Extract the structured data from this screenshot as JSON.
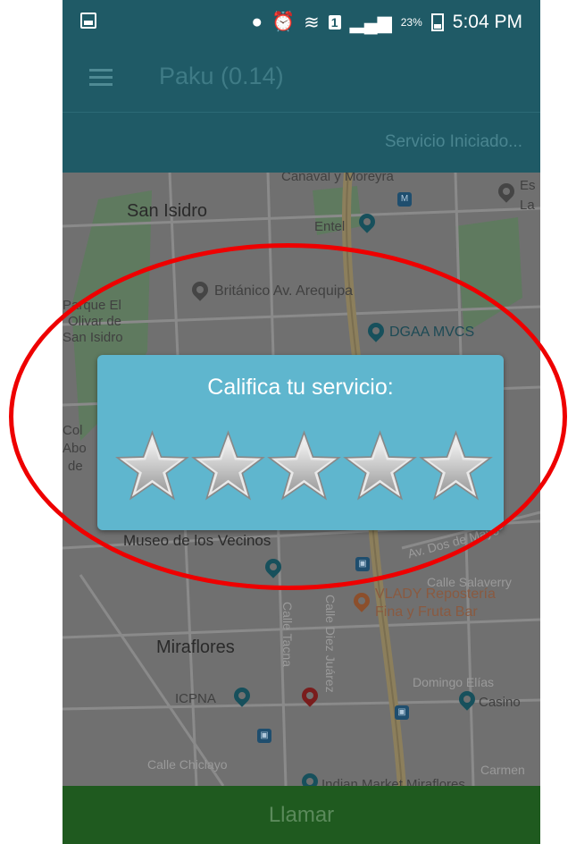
{
  "status_bar": {
    "battery_percent": "23%",
    "time": "5:04 PM",
    "sim": "1",
    "icons": [
      "location-icon",
      "alarm-icon",
      "wifi-icon",
      "sim-icon",
      "signal-icon",
      "battery-icon"
    ]
  },
  "toolbar": {
    "title": "Paku (0.14)"
  },
  "service_status": {
    "text": "Servicio Iniciado..."
  },
  "map": {
    "labels": {
      "san_isidro": "San Isidro",
      "canaval": "Canaval y Moreyra",
      "entel": "Entel",
      "britanico": "Británico Av. Arequipa",
      "parque_1": "Parque El",
      "parque_2": "Olivar de",
      "parque_3": "San Isidro",
      "dgaa": "DGAA MVCS",
      "es": "Es",
      "la": "La",
      "museo": "Museo de los Vecinos",
      "vlady_1": "VLADY Repostería",
      "vlady_2": "Fina y Fruta Bar",
      "calle_salaverry": "Calle Salaverry",
      "miraflores": "Miraflores",
      "icpna": "ICPNA",
      "casino": "Casino",
      "calle_chiclayo": "Calle Chiclayo",
      "carmen": "Carmen",
      "indian": "Indian Market Miraflores",
      "col_1": "Col",
      "col_2": "Abo",
      "col_3": "de",
      "domingo_elias": "Domingo Elías",
      "calle_tacna": "Calle Tacna",
      "calle_diez": "Calle Diez Juárez",
      "av_dos": "Av. Dos de Mayo"
    },
    "colors": {
      "background": "#707070",
      "park": "#5f7a5f",
      "road_major": "#8c7f5c"
    }
  },
  "rating_dialog": {
    "title": "Califica tu servicio:",
    "max_stars": 5,
    "selected_stars": 0,
    "background": "#5fb6ce"
  },
  "footer": {
    "call_label": "Llamar"
  },
  "colors": {
    "primary": "#1f5a66",
    "footer": "#1f5a1f",
    "highlight": "#ee0000"
  }
}
